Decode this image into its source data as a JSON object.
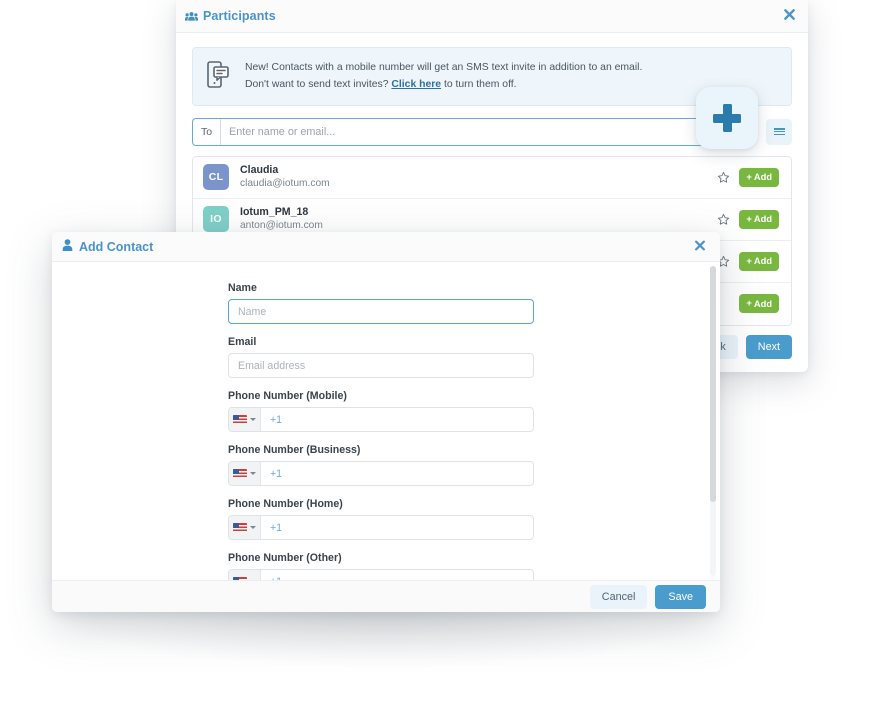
{
  "participants": {
    "title": "Participants",
    "title_icon": "people-group-icon",
    "close_icon": "close-x-icon",
    "notice": {
      "icon": "mobile-sms-icon",
      "line1": "New! Contacts with a mobile number will get an SMS text invite in addition to an email.",
      "line2_before": "Don't want to send text invites?",
      "link": "Click here",
      "line2_after": "to turn them off."
    },
    "to_label": "To",
    "to_placeholder": "Enter name or email...",
    "to_value": "",
    "menu_icon": "hamburger-menu-icon",
    "add_fab_icon": "plus-icon",
    "contacts": [
      {
        "initials": "CL",
        "name": "Claudia",
        "email": "claudia@iotum.com",
        "avatar_color": "#7b94cc",
        "star_icon": "star-outline-icon",
        "add_label": "Add"
      },
      {
        "initials": "IO",
        "name": "Iotum_PM_18",
        "email": "anton@iotum.com",
        "avatar_color": "#7fd0c8",
        "star_icon": "star-outline-icon",
        "add_label": "Add"
      },
      {
        "initials": "",
        "name": "",
        "email": "",
        "avatar_color": "#d8ab7e",
        "star_icon": "star-outline-icon",
        "add_label": "Add"
      },
      {
        "initials": "",
        "name": "",
        "email": "",
        "avatar_color": "#d8ab7e",
        "star_icon": "",
        "add_label": "Add"
      }
    ],
    "back_label": "Back",
    "next_label": "Next"
  },
  "add_contact": {
    "title": "Add Contact",
    "title_icon": "person-icon",
    "close_icon": "close-x-icon",
    "fields": [
      {
        "label": "Name",
        "type": "text",
        "placeholder": "Name",
        "value": "",
        "focused": true
      },
      {
        "label": "Email",
        "type": "text",
        "placeholder": "Email address",
        "value": "",
        "focused": false
      },
      {
        "label": "Phone Number (Mobile)",
        "type": "phone",
        "placeholder": "+1",
        "value": "",
        "flag": "us-flag-icon"
      },
      {
        "label": "Phone Number (Business)",
        "type": "phone",
        "placeholder": "+1",
        "value": "",
        "flag": "us-flag-icon"
      },
      {
        "label": "Phone Number (Home)",
        "type": "phone",
        "placeholder": "+1",
        "value": "",
        "flag": "us-flag-icon"
      },
      {
        "label": "Phone Number (Other)",
        "type": "phone",
        "placeholder": "+1",
        "value": "",
        "flag": "us-flag-icon"
      }
    ],
    "cancel_label": "Cancel",
    "save_label": "Save"
  },
  "colors": {
    "accent_blue": "#4a9ccd",
    "title_blue": "#4a93c9",
    "add_green": "#79b83f",
    "notice_bg": "#eef6fb",
    "fab_bg": "#eaf4fb"
  }
}
